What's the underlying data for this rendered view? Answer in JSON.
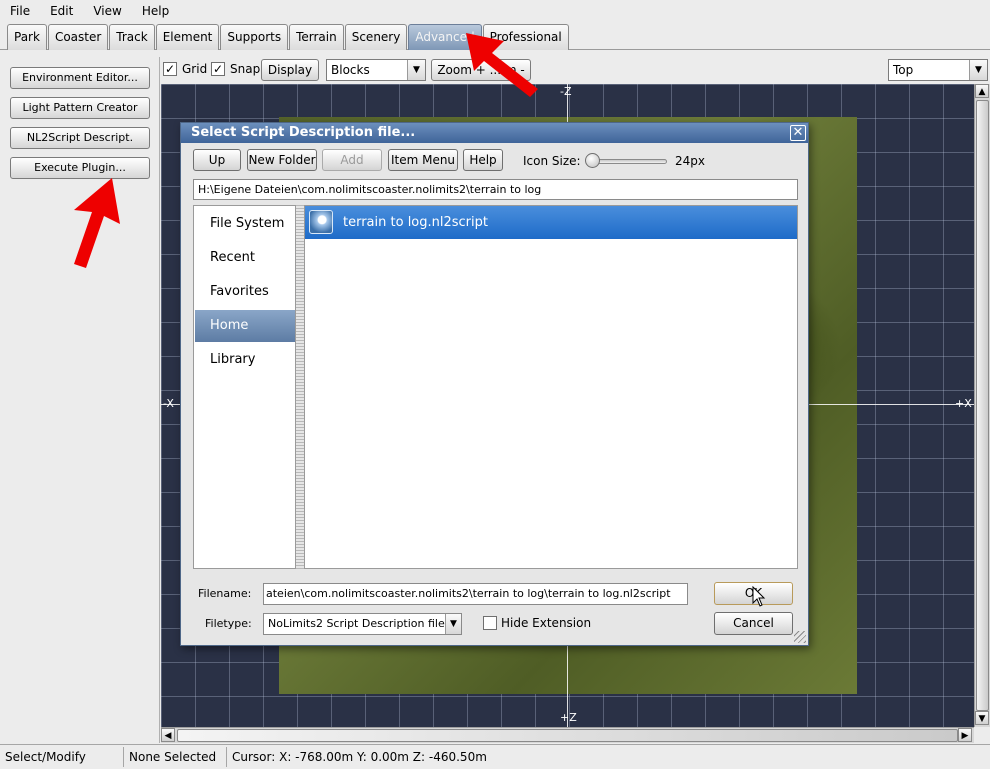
{
  "menubar": {
    "items": [
      "File",
      "Edit",
      "View",
      "Help"
    ]
  },
  "tabs": [
    {
      "label": "Park"
    },
    {
      "label": "Coaster"
    },
    {
      "label": "Track"
    },
    {
      "label": "Element"
    },
    {
      "label": "Supports"
    },
    {
      "label": "Terrain"
    },
    {
      "label": "Scenery"
    },
    {
      "label": "Advanced",
      "active": true
    },
    {
      "label": "Professional"
    }
  ],
  "sidebar": {
    "buttons": [
      "Environment Editor...",
      "Light Pattern Creator",
      "NL2Script Descript.",
      "Execute Plugin..."
    ]
  },
  "view_toolbar": {
    "grid_label": "Grid",
    "grid_checked": true,
    "snap_label": "Snap",
    "snap_checked": true,
    "display_button": "Display",
    "mode_select": "Blocks",
    "zoom_button": "Zoom + ... m -",
    "view_select": "Top"
  },
  "viewport": {
    "axis_labels": {
      "top": "-Z",
      "bottom": "+Z",
      "left": "-X",
      "right": "+X"
    }
  },
  "dialog": {
    "title": "Select Script Description file...",
    "toolbar": {
      "up": "Up",
      "new_folder": "New Folder",
      "add": "Add",
      "item_menu": "Item Menu",
      "help": "Help",
      "icon_size_label": "Icon Size:",
      "icon_size_value": "24px"
    },
    "path": "H:\\Eigene Dateien\\com.nolimitscoaster.nolimits2\\terrain to log",
    "places": [
      {
        "label": "File System"
      },
      {
        "label": "Recent"
      },
      {
        "label": "Favorites"
      },
      {
        "label": "Home",
        "selected": true
      },
      {
        "label": "Library"
      }
    ],
    "files": [
      {
        "name": "terrain to log.nl2script",
        "selected": true
      }
    ],
    "filename_label": "Filename:",
    "filename_value": "ateien\\com.nolimitscoaster.nolimits2\\terrain to log\\terrain to log.nl2script",
    "filetype_label": "Filetype:",
    "filetype_value": "NoLimits2 Script Description file",
    "hide_extension_label": "Hide Extension",
    "hide_extension_checked": false,
    "ok": "OK",
    "cancel": "Cancel"
  },
  "status": {
    "mode": "Select/Modify",
    "selection": "None Selected",
    "cursor": "Cursor: X: -768.00m Y: 0.00m Z: -460.50m"
  },
  "colors": {
    "annotation_arrow": "#ee0000",
    "active_tab": "#8aa2c0",
    "selection": "#2a78d4"
  }
}
